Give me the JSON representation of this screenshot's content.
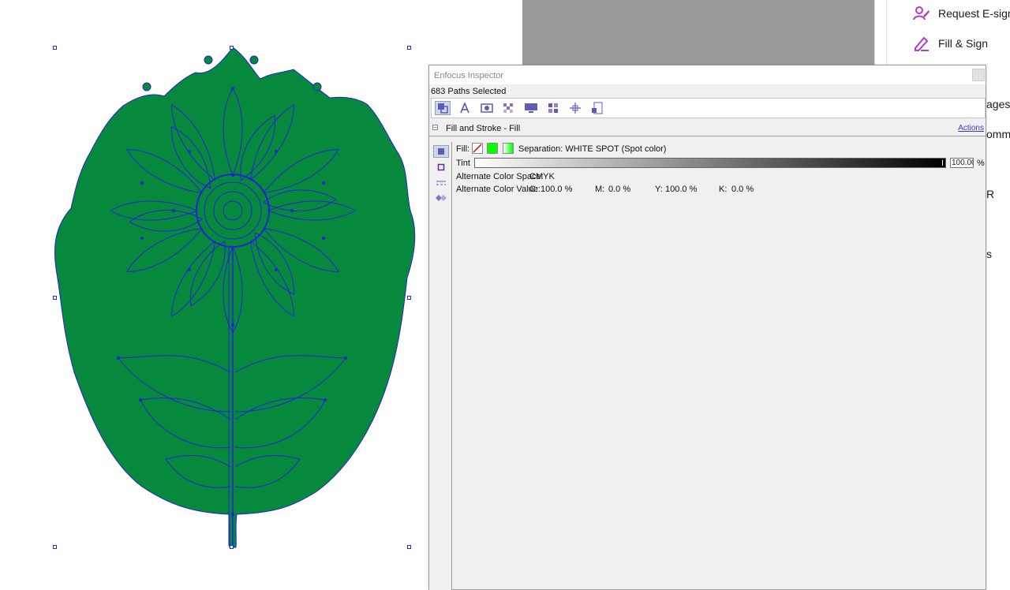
{
  "tools_pane": {
    "request_esign": "Request E-signa",
    "fill_sign": "Fill & Sign",
    "frag_ages": "ages",
    "frag_omme": "omme",
    "frag_r": "R",
    "frag_s": "s"
  },
  "inspector": {
    "title": "Enfocus Inspector",
    "selection": "683 Paths Selected",
    "toolbar_icons": [
      "fill-stroke-icon",
      "text-icon",
      "image-icon",
      "transparency-icon",
      "display-icon",
      "color-mode-icon",
      "position-icon",
      "document-icon"
    ],
    "section_title": "Fill and Stroke - Fill",
    "actions_label": "Actions",
    "side_icons": [
      "fill-mode-icon",
      "stroke-mode-icon",
      "line-style-icon",
      "overprint-icon"
    ],
    "fill_label": "Fill:",
    "separation": "Separation: WHITE SPOT (Spot color)",
    "tint_label": "Tint",
    "tint_value": "100.00",
    "tint_unit": "%",
    "alt_space_label": "Alternate Color Space:",
    "alt_space_value": "CMYK",
    "alt_value_label": "Alternate Color Value:",
    "c_label": "C:",
    "c_value": "100.0 %",
    "m_label": "M:",
    "m_value": "0.0 %",
    "y_label": "Y:",
    "y_value": "100.0 %",
    "k_label": "K:",
    "k_value": "0.0 %"
  },
  "colors": {
    "artwork_fill": "#06893c",
    "path_stroke": "#2323d6",
    "spot_swatch": "#00ff00",
    "accent_link": "#3a3acc",
    "tool_icon": "#b23cc8"
  }
}
